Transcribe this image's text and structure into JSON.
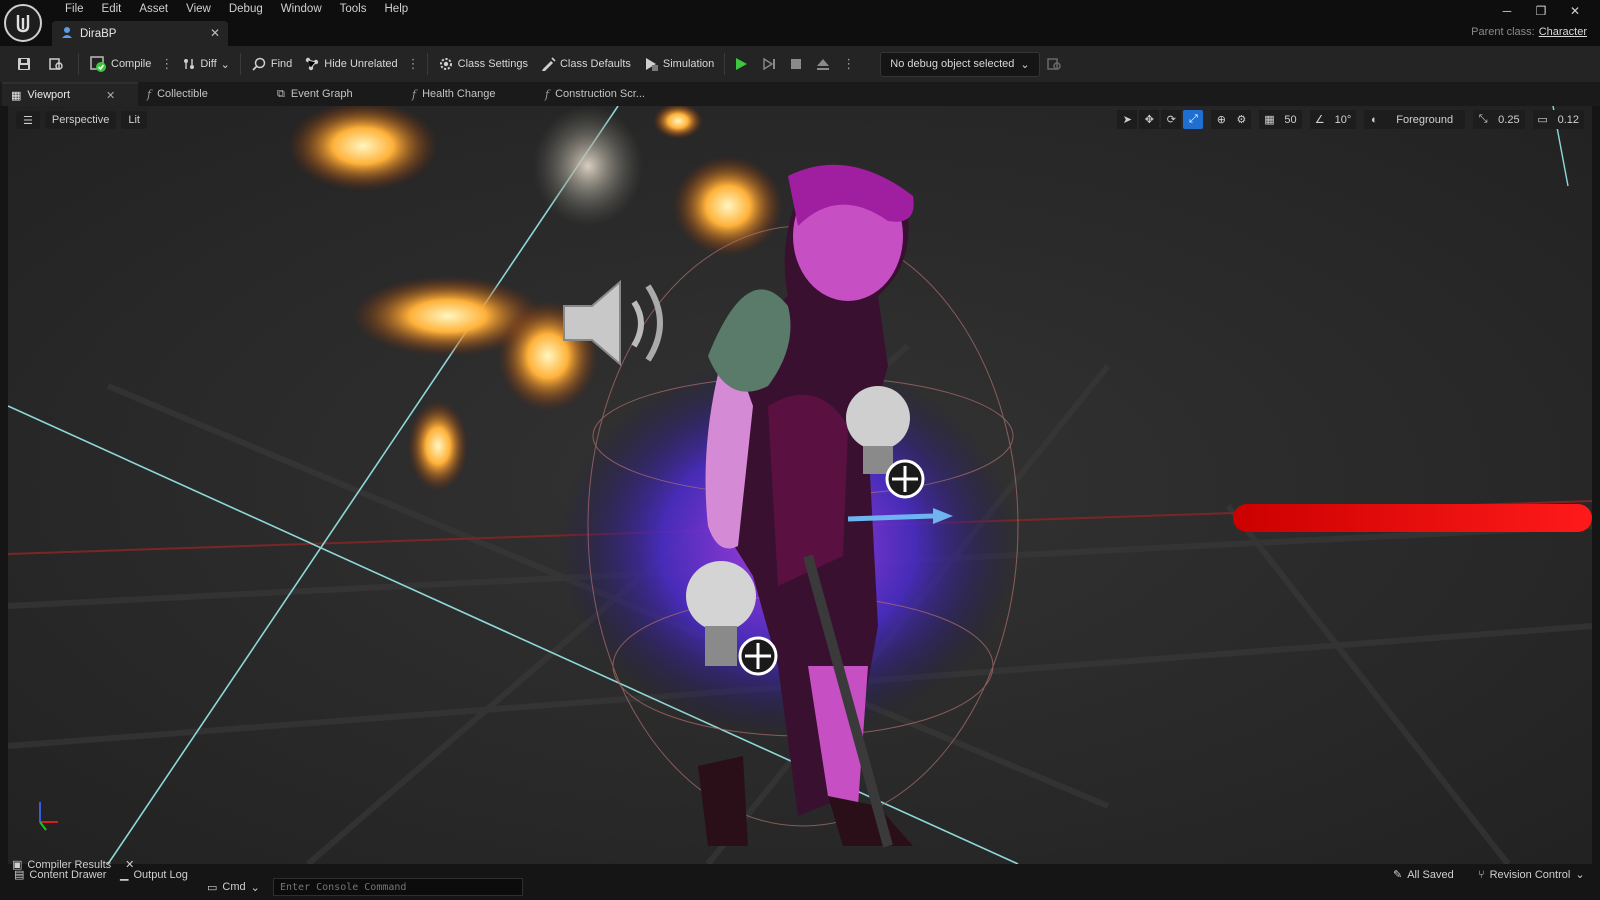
{
  "window": {
    "menu": [
      "File",
      "Edit",
      "Asset",
      "View",
      "Debug",
      "Window",
      "Tools",
      "Help"
    ],
    "asset_tab": "DiraBP",
    "parent_class_label": "Parent class:",
    "parent_class_value": "Character"
  },
  "toolbar": {
    "compile": "Compile",
    "diff": "Diff",
    "find": "Find",
    "hide_unrelated": "Hide Unrelated",
    "class_settings": "Class Settings",
    "class_defaults": "Class Defaults",
    "simulation": "Simulation",
    "debug_object": "No debug object selected"
  },
  "editor_tabs": [
    {
      "label": "Viewport"
    },
    {
      "label": "Collectible"
    },
    {
      "label": "Event Graph"
    },
    {
      "label": "Health Change"
    },
    {
      "label": "Construction Scr..."
    }
  ],
  "viewport": {
    "view_mode": "Perspective",
    "lighting": "Lit",
    "grid_snap": "50",
    "rotation_snap": "10°",
    "layer": "Foreground",
    "scale_snap": "0.25",
    "camera_speed": "0.12"
  },
  "bottom": {
    "compiler_results": "Compiler Results",
    "content_drawer": "Content Drawer",
    "output_log": "Output Log",
    "cmd": "Cmd",
    "console_placeholder": "Enter Console Command",
    "all_saved": "All Saved",
    "revision_control": "Revision Control"
  },
  "colors": {
    "accent_blue": "#1f6fd1",
    "play_green": "#3ec73e",
    "axis_red": "#d81414"
  }
}
